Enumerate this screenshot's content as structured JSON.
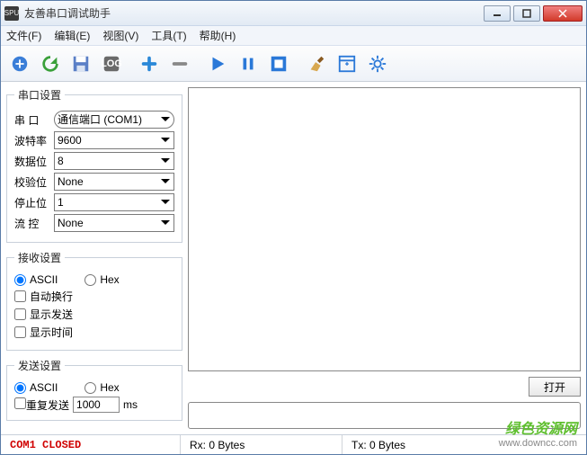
{
  "window": {
    "title": "友善串口调试助手",
    "app_icon_text": "SPU"
  },
  "menu": {
    "file": "文件(F)",
    "edit": "编辑(E)",
    "view": "视图(V)",
    "tools": "工具(T)",
    "help": "帮助(H)"
  },
  "serial_settings": {
    "legend": "串口设置",
    "port_label": "串 口",
    "port_value": "通信端口 (COM1)",
    "baud_label": "波特率",
    "baud_value": "9600",
    "databits_label": "数据位",
    "databits_value": "8",
    "parity_label": "校验位",
    "parity_value": "None",
    "stopbits_label": "停止位",
    "stopbits_value": "1",
    "flow_label": "流 控",
    "flow_value": "None"
  },
  "receive_settings": {
    "legend": "接收设置",
    "ascii_label": "ASCII",
    "hex_label": "Hex",
    "auto_wrap": "自动换行",
    "show_send": "显示发送",
    "show_time": "显示时间"
  },
  "send_settings": {
    "legend": "发送设置",
    "ascii_label": "ASCII",
    "hex_label": "Hex",
    "repeat_label": "重复发送",
    "repeat_value": "1000",
    "repeat_unit": "ms"
  },
  "buttons": {
    "open": "打开"
  },
  "status": {
    "port": "COM1 CLOSED",
    "rx": "Rx: 0 Bytes",
    "tx": "Tx: 0 Bytes"
  },
  "watermark": {
    "line1": "绿色资源网",
    "line2": "www.downcc.com"
  }
}
